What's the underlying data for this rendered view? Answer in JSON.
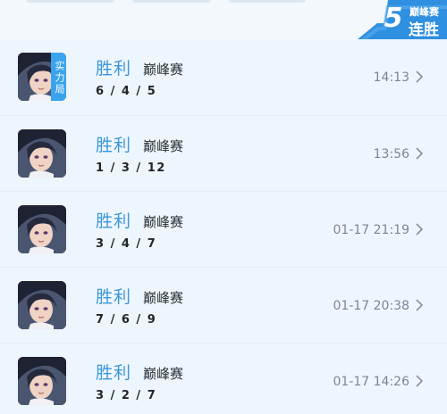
{
  "header": {
    "streak_count": "5",
    "streak_mode": "巅峰赛",
    "streak_label": "连胜",
    "streak_color": "#2f8fe0"
  },
  "colors": {
    "win": "#3b97d9",
    "badge": "#3aa3ee",
    "background": "#eef6fd"
  },
  "matches": [
    {
      "result": "胜利",
      "mode": "巅峰赛",
      "kda": "6 / 4 / 5",
      "time": "14:13",
      "badge": "实力局"
    },
    {
      "result": "胜利",
      "mode": "巅峰赛",
      "kda": "1 / 3 / 12",
      "time": "13:56"
    },
    {
      "result": "胜利",
      "mode": "巅峰赛",
      "kda": "3 / 4 / 7",
      "time": "01-17 21:19"
    },
    {
      "result": "胜利",
      "mode": "巅峰赛",
      "kda": "7 / 6 / 9",
      "time": "01-17 20:38"
    },
    {
      "result": "胜利",
      "mode": "巅峰赛",
      "kda": "3 / 2 / 7",
      "time": "01-17 14:26"
    }
  ]
}
